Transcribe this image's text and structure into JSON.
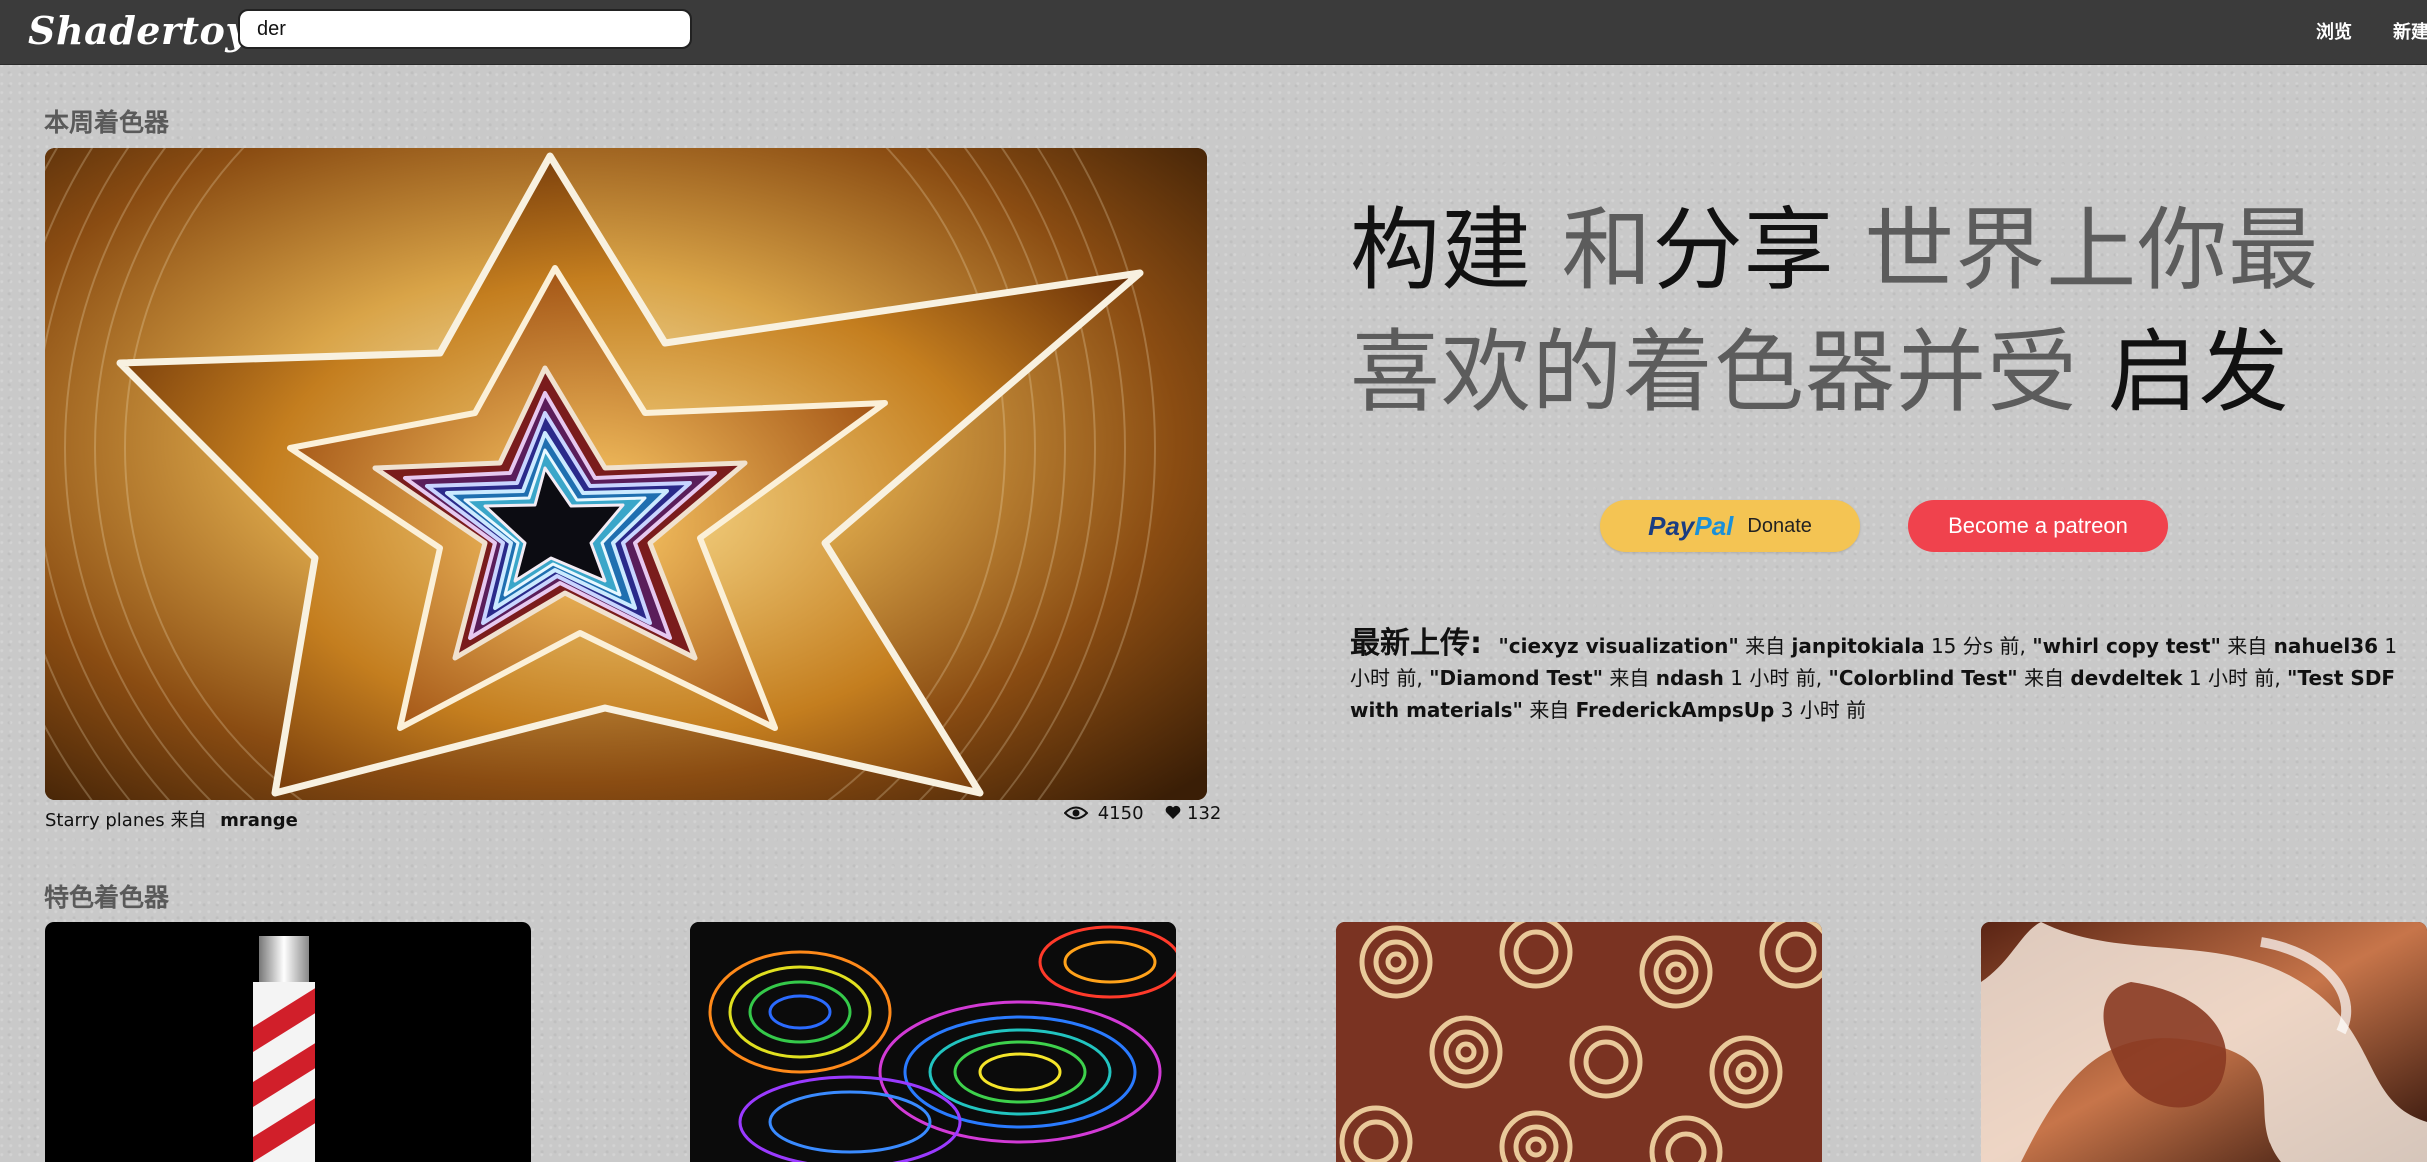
{
  "header": {
    "logo": "Shadertoy",
    "search_value": "der",
    "nav": [
      "浏览",
      "新建"
    ]
  },
  "shader_of_week": {
    "section_title": "本周着色器",
    "name": "Starry planes",
    "by": "来自",
    "author": "mrange",
    "views": "4150",
    "likes": "132"
  },
  "headline": {
    "part1": "构建",
    "part2": " 和",
    "part3": "分享",
    "part4": " 世界上你最喜欢的着色器并受",
    "part5": " 启发"
  },
  "donate": {
    "paypal_logo_1": "Pay",
    "paypal_logo_2": "Pal",
    "paypal_label": "Donate",
    "patreon_label": "Become a patreon"
  },
  "latest": {
    "heading": "最新上传:",
    "items": [
      {
        "title": "\"ciexyz visualization\"",
        "by": "来自",
        "author": "janpitokiala",
        "time": "15 分s 前,"
      },
      {
        "title": "\"whirl copy test\"",
        "by": "来自",
        "author": "nahuel36",
        "time": "1 小时 前,"
      },
      {
        "title": "\"Diamond Test\"",
        "by": "来自",
        "author": "ndash",
        "time": "1 小时 前,"
      },
      {
        "title": "\"Colorblind Test\"",
        "by": "来自",
        "author": "devdeltek",
        "time": "1 小时 前,"
      },
      {
        "title": "\"Test SDF with materials\"",
        "by": "来自",
        "author": "FrederickAmpsUp",
        "time": "3 小时 前"
      }
    ]
  },
  "featured": {
    "section_title": "特色着色器",
    "thumb_names": [
      "barber-pole-shader",
      "contour-lines-shader",
      "spiral-pattern-shader",
      "fluid-swirl-shader"
    ]
  },
  "colors": {
    "header_bg": "#3b3b3b",
    "page_bg": "#c9c9c9",
    "paypal_bg": "#f4c453",
    "patreon_bg": "#f0424d"
  }
}
